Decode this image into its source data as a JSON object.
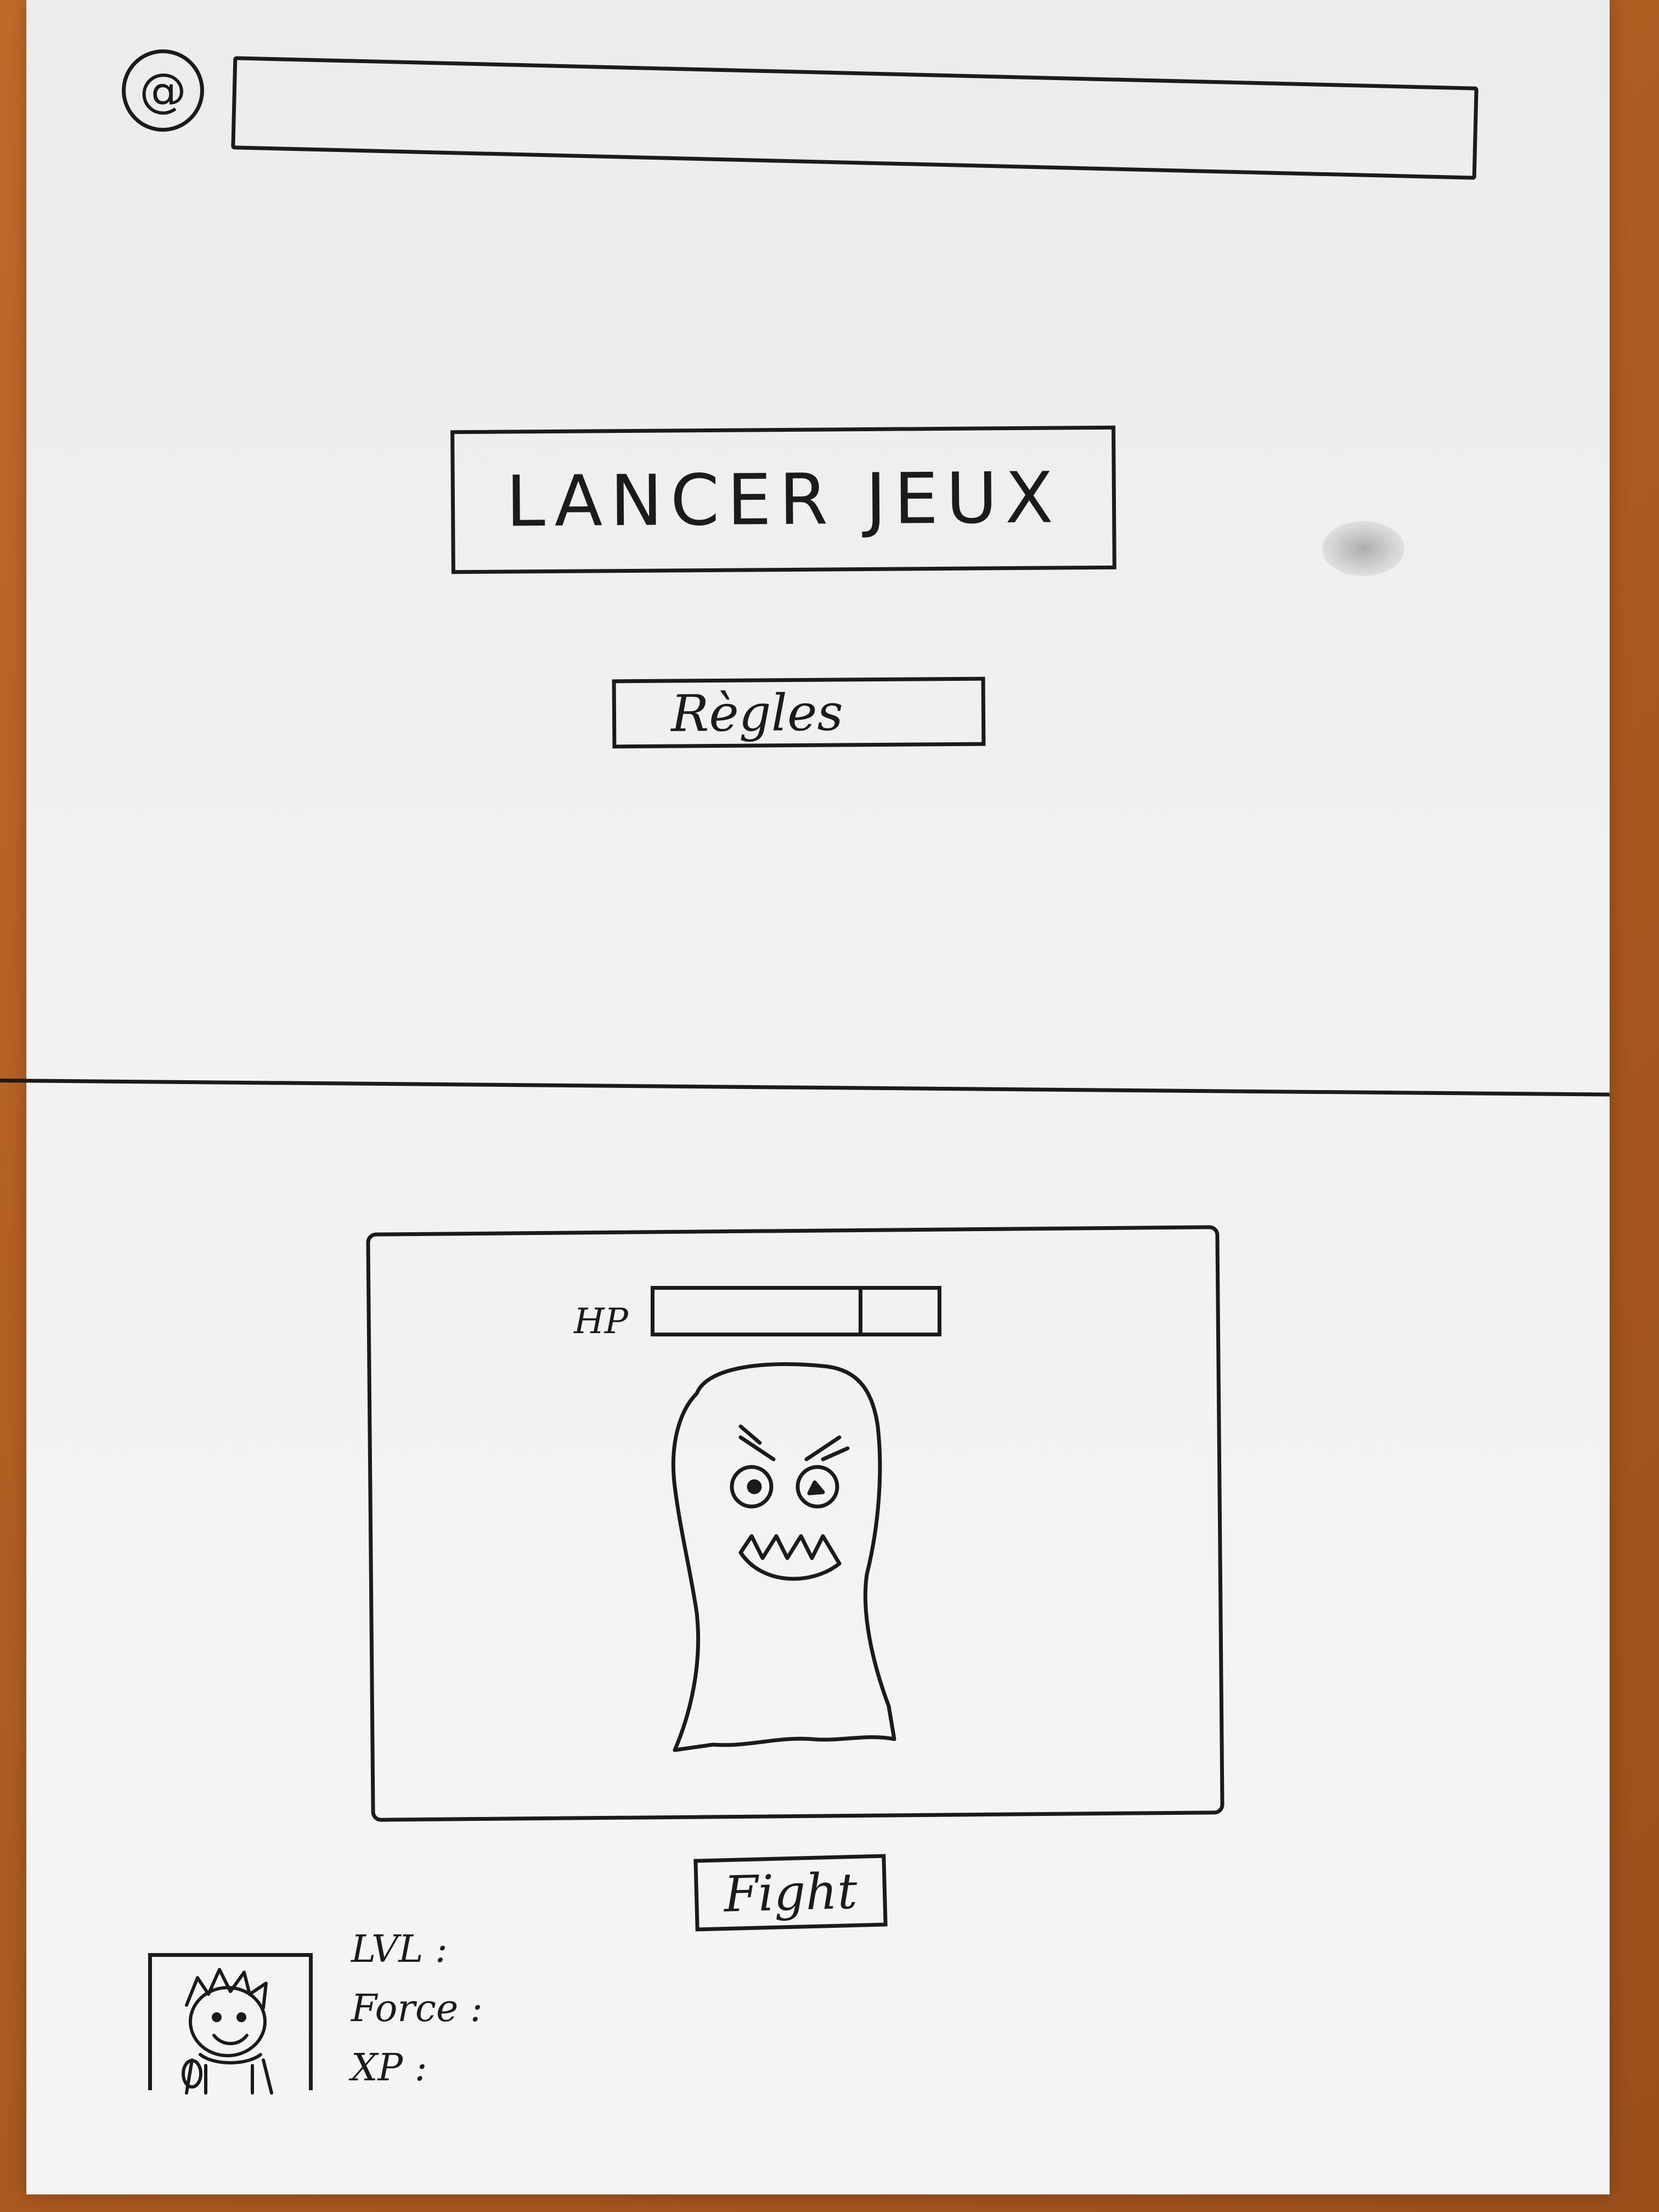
{
  "header": {
    "at_symbol": "@",
    "address_value": ""
  },
  "menu": {
    "launch_label": "LANCER JEUX",
    "rules_label": "Règles"
  },
  "game": {
    "hp_label": "HP",
    "hp_fraction": 0.72,
    "fight_label": "Fight"
  },
  "player": {
    "stats": [
      {
        "label": "LVL",
        "value": ""
      },
      {
        "label": "Force",
        "value": ""
      },
      {
        "label": "XP",
        "value": ""
      }
    ]
  },
  "colors": {
    "ink": "#1b1b1b",
    "paper": "#f1f1f1",
    "desk": "#b45e22"
  },
  "icons": {
    "at": "at-icon",
    "monster": "monster-sketch",
    "avatar": "player-avatar-sketch"
  }
}
